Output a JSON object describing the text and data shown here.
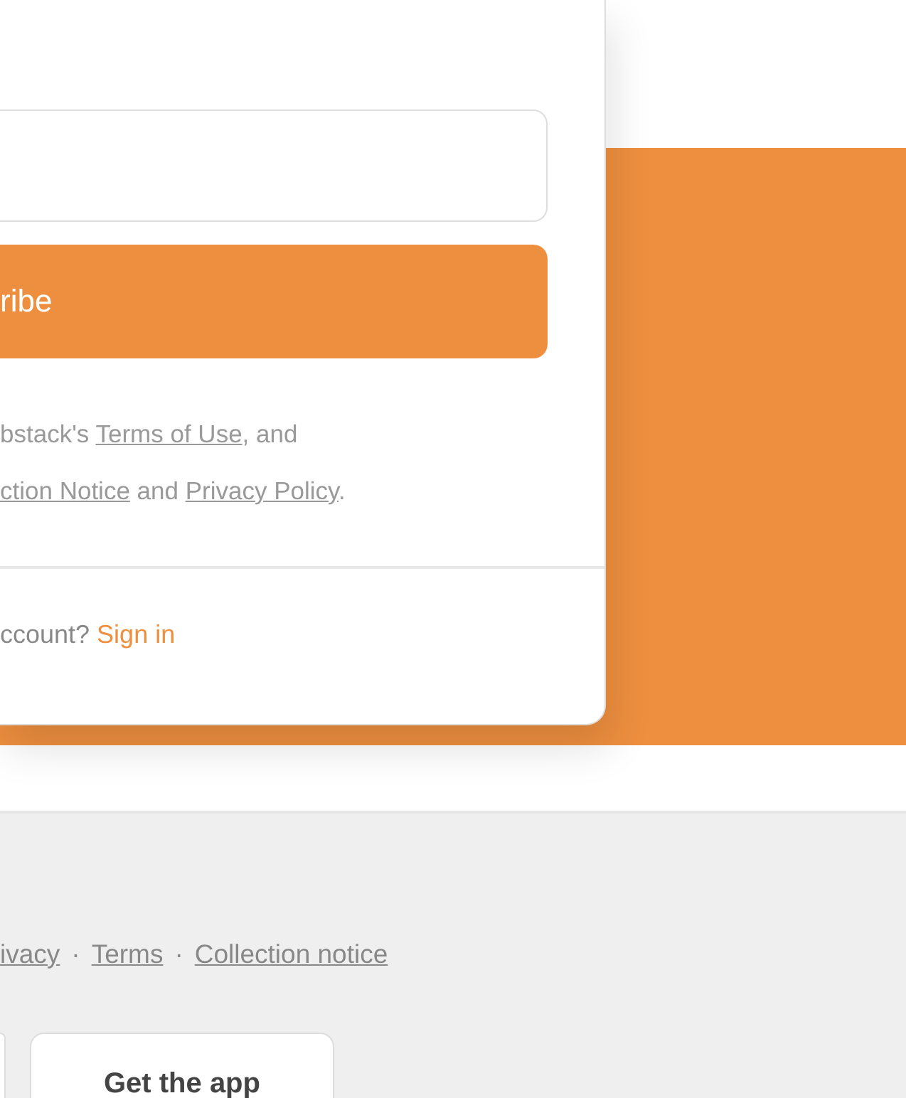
{
  "signup_card": {
    "subscribe_button": {
      "label": "ribe"
    },
    "legal_lines": [
      [
        {
          "kind": "text",
          "text": "bstack's "
        },
        {
          "kind": "link",
          "text": "Terms of Use"
        },
        {
          "kind": "text",
          "text": ", and"
        }
      ],
      [
        {
          "kind": "link",
          "text": "ction Notice"
        },
        {
          "kind": "text",
          "text": " and "
        },
        {
          "kind": "link",
          "text": "Privacy Policy"
        },
        {
          "kind": "text",
          "text": "."
        }
      ]
    ],
    "sign_in_prompt": {
      "text": "ccount? ",
      "link": "Sign in"
    }
  },
  "footer": {
    "links": [
      "ivacy",
      "Terms",
      "Collection notice"
    ],
    "separator": "·",
    "app_button": {
      "label": "Get the app"
    }
  }
}
